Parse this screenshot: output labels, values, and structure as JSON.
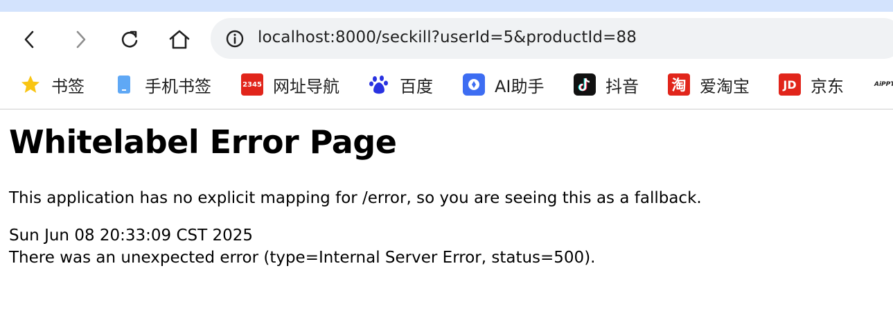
{
  "browser": {
    "url": "localhost:8000/seckill?userId=5&productId=88",
    "bookmarks": [
      {
        "label": "书签",
        "icon": "star-icon"
      },
      {
        "label": "手机书签",
        "icon": "phone-icon"
      },
      {
        "label": "网址导航",
        "icon": "navigation-icon"
      },
      {
        "label": "百度",
        "icon": "baidu-paw-icon"
      },
      {
        "label": "AI助手",
        "icon": "ai-assistant-icon"
      },
      {
        "label": "抖音",
        "icon": "tiktok-icon"
      },
      {
        "label": "爱淘宝",
        "icon": "taobao-icon"
      },
      {
        "label": "京东",
        "icon": "jd-icon"
      },
      {
        "label": "AiPPT",
        "icon": "aippt-icon"
      }
    ],
    "icon_glyphs": {
      "navigation": "2345",
      "taobao": "淘",
      "jd": "JD"
    }
  },
  "page": {
    "title": "Whitelabel Error Page",
    "message": "This application has no explicit mapping for /error, so you are seeing this as a fallback.",
    "timestamp": "Sun Jun 08 20:33:09 CST 2025",
    "error_detail": "There was an unexpected error (type=Internal Server Error, status=500)."
  },
  "colors": {
    "top_strip": "#d3e3fd",
    "omnibox": "#f0f2f4",
    "star": "#f9c513",
    "baidu": "#2932e1",
    "red_brand": "#e1251b"
  }
}
